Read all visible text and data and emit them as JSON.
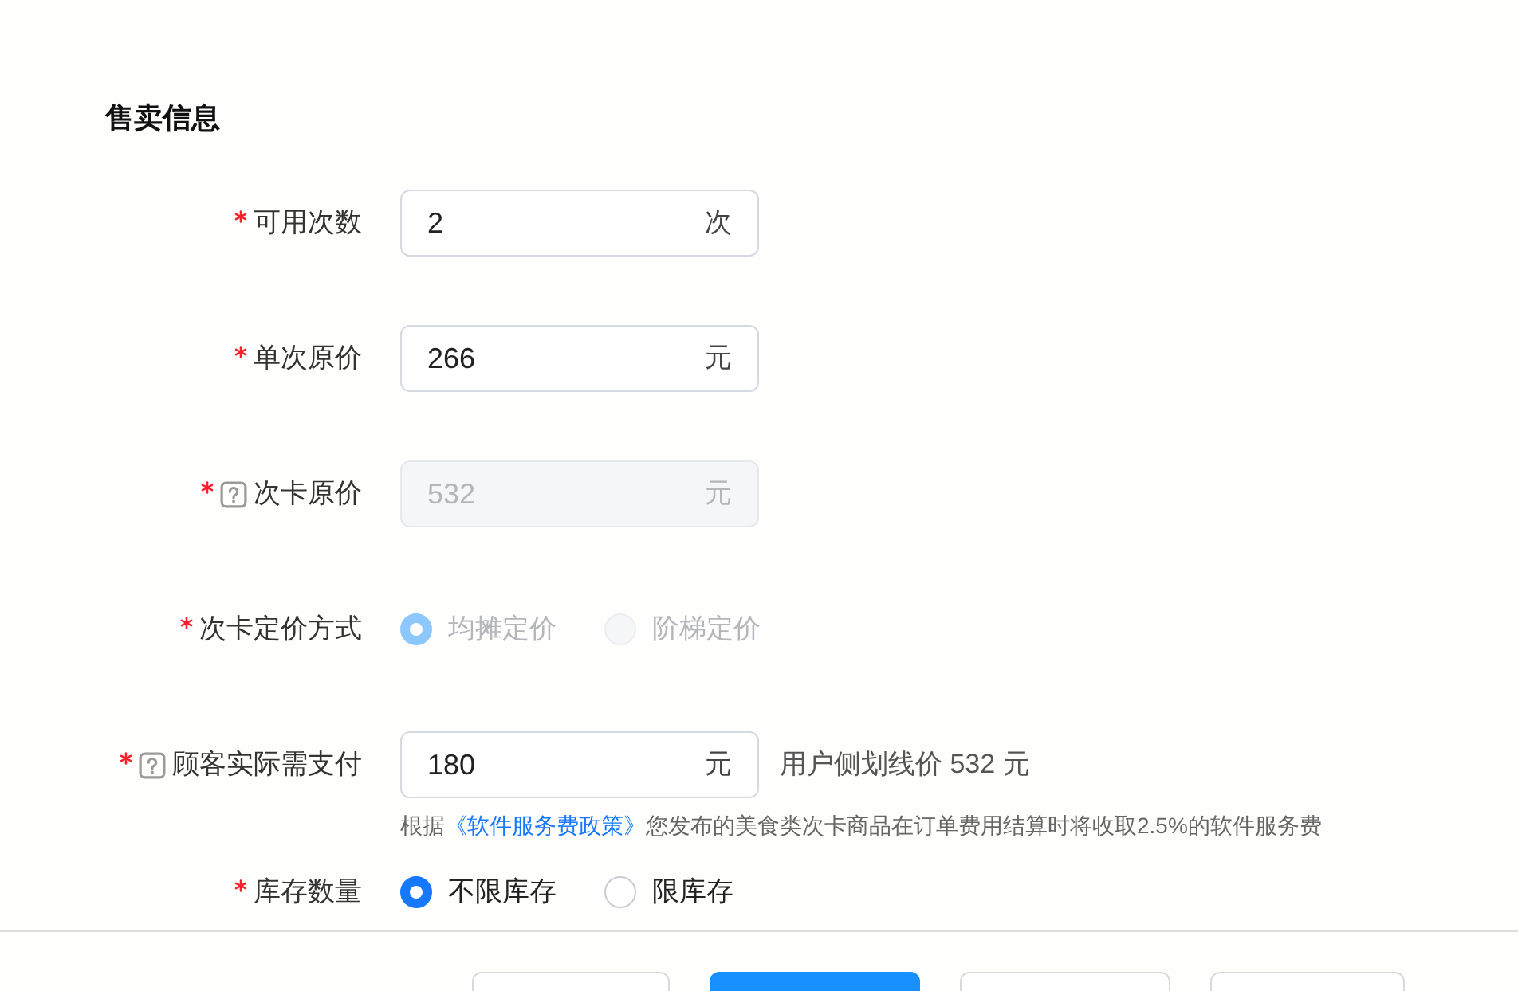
{
  "section_title": "售卖信息",
  "fields": [
    {
      "kind": "input",
      "label": "可用次数",
      "required": true,
      "help": false,
      "value": "2",
      "unit": "次",
      "disabled": false
    },
    {
      "kind": "input",
      "label": "单次原价",
      "required": true,
      "help": false,
      "value": "266",
      "unit": "元",
      "disabled": false
    },
    {
      "kind": "input",
      "label": "次卡原价",
      "required": true,
      "help": true,
      "value": "532",
      "unit": "元",
      "disabled": true
    },
    {
      "kind": "radio",
      "label": "次卡定价方式",
      "required": true,
      "help": false,
      "options": [
        {
          "label": "均摊定价",
          "selected": true,
          "disabled": true
        },
        {
          "label": "阶梯定价",
          "selected": false,
          "disabled": true
        }
      ]
    },
    {
      "kind": "input",
      "label": "顾客实际需支付",
      "required": true,
      "help": true,
      "value": "180",
      "unit": "元",
      "disabled": false,
      "suffix_text": "用户侧划线价 532 元",
      "hint": {
        "before": "根据",
        "link": "《软件服务费政策》",
        "after": "您发布的美食类次卡商品在订单费用结算时将收取2.5%的软件服务费"
      }
    },
    {
      "kind": "radio",
      "label": "库存数量",
      "required": true,
      "help": false,
      "options": [
        {
          "label": "不限库存",
          "selected": true,
          "disabled": false
        },
        {
          "label": "限库存",
          "selected": false,
          "disabled": false
        }
      ]
    }
  ],
  "footer_buttons": [
    {
      "kind": "default"
    },
    {
      "kind": "primary"
    },
    {
      "kind": "default"
    },
    {
      "kind": "default"
    }
  ]
}
